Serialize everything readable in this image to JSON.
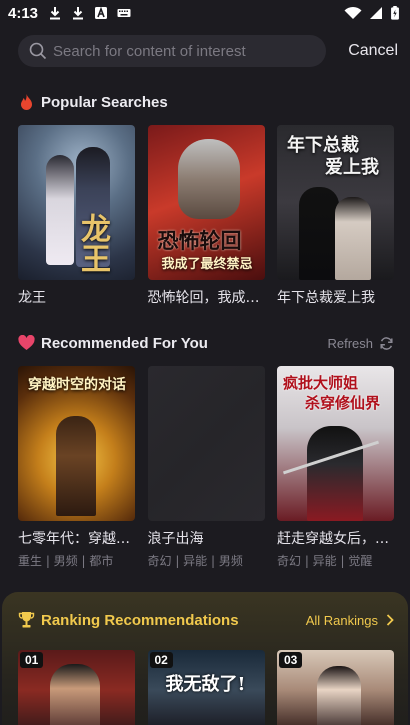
{
  "status_bar": {
    "time": "4:13"
  },
  "search": {
    "placeholder": "Search for content of interest",
    "value": "",
    "cancel_label": "Cancel"
  },
  "popular": {
    "title": "Popular Searches",
    "books": [
      {
        "title": "龙王",
        "cover_text": "龙王"
      },
      {
        "title": "恐怖轮回，我成了最终禁忌",
        "cover_text": "恐怖轮回",
        "cover_sub": "我成了最终禁忌"
      },
      {
        "title": "年下总裁爱上我",
        "cover_text": "年下总裁",
        "cover_sub": "爱上我"
      }
    ]
  },
  "recommended": {
    "title": "Recommended For You",
    "refresh_label": "Refresh",
    "books": [
      {
        "title": "七零年代：穿越时空的对话",
        "tags": "重生 | 男频 | 都市",
        "cover_text": "穿越时空的对话"
      },
      {
        "title": "浪子出海",
        "tags": "奇幻 | 异能 | 男频"
      },
      {
        "title": "赶走穿越女后，疯批大师姐杀穿修仙界",
        "tags": "奇幻 | 异能 | 觉醒",
        "cover_text": "疯批大师姐",
        "cover_sub": "杀穿修仙界"
      }
    ]
  },
  "ranking": {
    "title": "Ranking Recommendations",
    "all_label": "All Rankings",
    "items": [
      {
        "rank": "01"
      },
      {
        "rank": "02",
        "cover_text": "我无敌了!"
      },
      {
        "rank": "03"
      }
    ]
  },
  "colors": {
    "background": "#1c1b20",
    "accent_gold": "#f1c94d",
    "fire": "#e8452e",
    "heart": "#e8456a"
  }
}
